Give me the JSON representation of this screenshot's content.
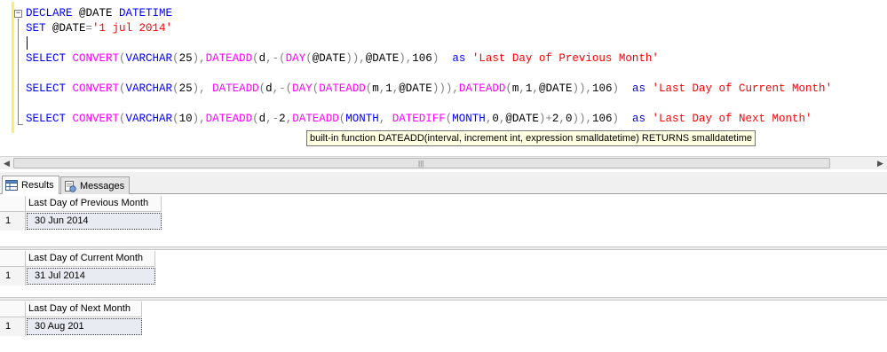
{
  "editor": {
    "outline_symbol": "−",
    "lines": [
      [
        [
          "kw",
          "DECLARE "
        ],
        [
          "tx",
          "@DATE "
        ],
        [
          "kw",
          "DATETIME"
        ]
      ],
      [
        [
          "kw",
          "SET "
        ],
        [
          "tx",
          "@DATE"
        ],
        [
          "gr",
          "="
        ],
        [
          "str",
          "'1 jul 2014'"
        ]
      ],
      [],
      [
        [
          "kw",
          "SELECT "
        ],
        [
          "fn",
          "CONVERT"
        ],
        [
          "gr",
          "("
        ],
        [
          "kw",
          "VARCHAR"
        ],
        [
          "gr",
          "("
        ],
        [
          "tx",
          "25"
        ],
        [
          "gr",
          "),"
        ],
        [
          "fn",
          "DATEADD"
        ],
        [
          "gr",
          "("
        ],
        [
          "tx",
          "d"
        ],
        [
          "gr",
          ",-("
        ],
        [
          "fn",
          "DAY"
        ],
        [
          "gr",
          "("
        ],
        [
          "tx",
          "@DATE"
        ],
        [
          "gr",
          "))"
        ],
        [
          "gr",
          ","
        ],
        [
          "tx",
          "@DATE"
        ],
        [
          "gr",
          ")"
        ],
        [
          "gr",
          ","
        ],
        [
          "tx",
          "106"
        ],
        [
          "gr",
          ")  "
        ],
        [
          "kw",
          "as "
        ],
        [
          "str",
          "'Last Day of Previous Month'"
        ]
      ],
      [],
      [
        [
          "kw",
          "SELECT "
        ],
        [
          "fn",
          "CONVERT"
        ],
        [
          "gr",
          "("
        ],
        [
          "kw",
          "VARCHAR"
        ],
        [
          "gr",
          "("
        ],
        [
          "tx",
          "25"
        ],
        [
          "gr",
          "), "
        ],
        [
          "fn",
          "DATEADD"
        ],
        [
          "gr",
          "("
        ],
        [
          "tx",
          "d"
        ],
        [
          "gr",
          ",-("
        ],
        [
          "fn",
          "DAY"
        ],
        [
          "gr",
          "("
        ],
        [
          "fn",
          "DATEADD"
        ],
        [
          "gr",
          "("
        ],
        [
          "tx",
          "m"
        ],
        [
          "gr",
          ","
        ],
        [
          "tx",
          "1"
        ],
        [
          "gr",
          ","
        ],
        [
          "tx",
          "@DATE"
        ],
        [
          "gr",
          ")))"
        ],
        [
          "gr",
          ","
        ],
        [
          "fn",
          "DATEADD"
        ],
        [
          "gr",
          "("
        ],
        [
          "tx",
          "m"
        ],
        [
          "gr",
          ","
        ],
        [
          "tx",
          "1"
        ],
        [
          "gr",
          ","
        ],
        [
          "tx",
          "@DATE"
        ],
        [
          "gr",
          "))"
        ],
        [
          "gr",
          ","
        ],
        [
          "tx",
          "106"
        ],
        [
          "gr",
          ")  "
        ],
        [
          "kw",
          "as "
        ],
        [
          "str",
          "'Last Day of Current Month'"
        ]
      ],
      [],
      [
        [
          "kw",
          "SELECT "
        ],
        [
          "fn",
          "CONVERT"
        ],
        [
          "gr",
          "("
        ],
        [
          "kw",
          "VARCHAR"
        ],
        [
          "gr",
          "("
        ],
        [
          "tx",
          "10"
        ],
        [
          "gr",
          "),"
        ],
        [
          "fn",
          "DATEADD"
        ],
        [
          "gr",
          "("
        ],
        [
          "tx",
          "d"
        ],
        [
          "gr",
          ",-"
        ],
        [
          "tx",
          "2"
        ],
        [
          "gr",
          ","
        ],
        [
          "fn",
          "DATEADD"
        ],
        [
          "gr",
          "("
        ],
        [
          "kw",
          "MONTH"
        ],
        [
          "gr",
          ", "
        ],
        [
          "fn",
          "DATEDIFF"
        ],
        [
          "gr",
          "("
        ],
        [
          "kw",
          "MONTH"
        ],
        [
          "gr",
          ","
        ],
        [
          "tx",
          "0"
        ],
        [
          "gr",
          ","
        ],
        [
          "tx",
          "@DATE"
        ],
        [
          "gr",
          ")"
        ],
        [
          "gr",
          "+"
        ],
        [
          "tx",
          "2"
        ],
        [
          "gr",
          ","
        ],
        [
          "tx",
          "0"
        ],
        [
          "gr",
          "))"
        ],
        [
          "gr",
          ","
        ],
        [
          "tx",
          "106"
        ],
        [
          "gr",
          ")  "
        ],
        [
          "kw",
          "as "
        ],
        [
          "str",
          "'Last Day of Next Month'"
        ]
      ]
    ],
    "tooltip": "built-in function DATEADD(interval, increment int, expression smalldatetime) RETURNS smalldatetime"
  },
  "scrollbar": {
    "left_arrow": "◀",
    "right_arrow": "▶",
    "grip": "|||"
  },
  "tabs": [
    {
      "label": "Results",
      "icon": "grid-icon",
      "active": true
    },
    {
      "label": "Messages",
      "icon": "messages-icon",
      "active": false
    }
  ],
  "results": [
    {
      "header": "Last Day of Previous Month",
      "row_number": "1",
      "value": "30 Jun 2014"
    },
    {
      "header": "Last Day of Current Month",
      "row_number": "1",
      "value": "31 Jul 2014"
    },
    {
      "header": "Last Day of Next Month",
      "row_number": "1",
      "value": "30 Aug 201"
    }
  ],
  "colors": {
    "keyword": "#0000ff",
    "function": "#ff00ff",
    "string": "#ff0000",
    "operator": "#808080",
    "change_bar": "#ffee62"
  }
}
